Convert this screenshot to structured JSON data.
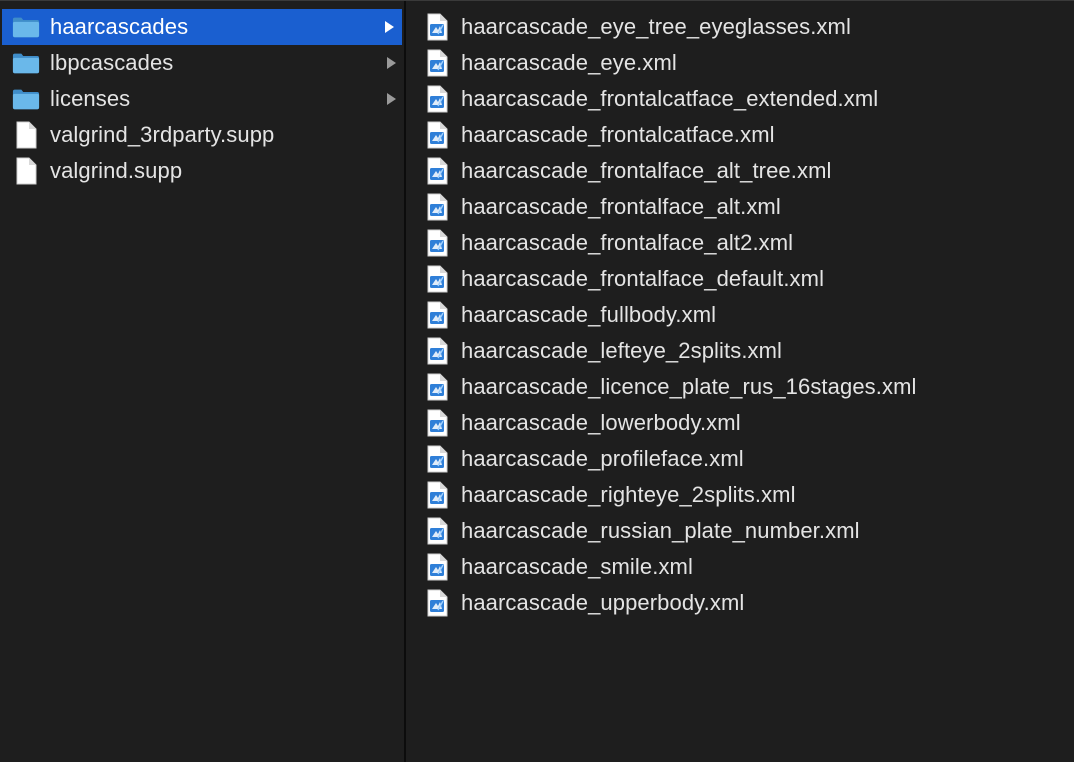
{
  "sidebar": {
    "items": [
      {
        "label": "haarcascades",
        "type": "folder",
        "icon": "folder-icon",
        "selected": true,
        "has_children": true
      },
      {
        "label": "lbpcascades",
        "type": "folder",
        "icon": "folder-icon",
        "selected": false,
        "has_children": true
      },
      {
        "label": "licenses",
        "type": "folder",
        "icon": "folder-icon",
        "selected": false,
        "has_children": true
      },
      {
        "label": "valgrind_3rdparty.supp",
        "type": "file",
        "icon": "document-icon",
        "selected": false,
        "has_children": false
      },
      {
        "label": "valgrind.supp",
        "type": "file",
        "icon": "document-icon",
        "selected": false,
        "has_children": false
      }
    ]
  },
  "files": {
    "items": [
      {
        "label": "haarcascade_eye_tree_eyeglasses.xml",
        "icon": "xml-file-icon"
      },
      {
        "label": "haarcascade_eye.xml",
        "icon": "xml-file-icon"
      },
      {
        "label": "haarcascade_frontalcatface_extended.xml",
        "icon": "xml-file-icon"
      },
      {
        "label": "haarcascade_frontalcatface.xml",
        "icon": "xml-file-icon"
      },
      {
        "label": "haarcascade_frontalface_alt_tree.xml",
        "icon": "xml-file-icon"
      },
      {
        "label": "haarcascade_frontalface_alt.xml",
        "icon": "xml-file-icon"
      },
      {
        "label": "haarcascade_frontalface_alt2.xml",
        "icon": "xml-file-icon"
      },
      {
        "label": "haarcascade_frontalface_default.xml",
        "icon": "xml-file-icon"
      },
      {
        "label": "haarcascade_fullbody.xml",
        "icon": "xml-file-icon"
      },
      {
        "label": "haarcascade_lefteye_2splits.xml",
        "icon": "xml-file-icon"
      },
      {
        "label": "haarcascade_licence_plate_rus_16stages.xml",
        "icon": "xml-file-icon"
      },
      {
        "label": "haarcascade_lowerbody.xml",
        "icon": "xml-file-icon"
      },
      {
        "label": "haarcascade_profileface.xml",
        "icon": "xml-file-icon"
      },
      {
        "label": "haarcascade_righteye_2splits.xml",
        "icon": "xml-file-icon"
      },
      {
        "label": "haarcascade_russian_plate_number.xml",
        "icon": "xml-file-icon"
      },
      {
        "label": "haarcascade_smile.xml",
        "icon": "xml-file-icon"
      },
      {
        "label": "haarcascade_upperbody.xml",
        "icon": "xml-file-icon"
      }
    ]
  },
  "colors": {
    "background": "#1e1e1e",
    "selection": "#1a5fd0",
    "text": "#e4e4e4",
    "folder": "#5fb1e6"
  }
}
